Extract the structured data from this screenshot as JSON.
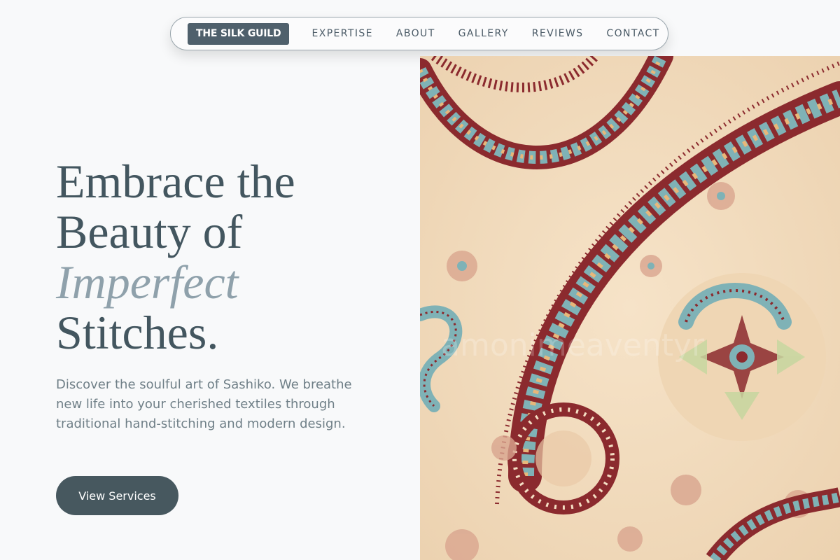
{
  "nav": {
    "logo": "THE SILK GUILD",
    "links": [
      "EXPERTISE",
      "ABOUT",
      "GALLERY",
      "REVIEWS",
      "CONTACT"
    ]
  },
  "hero": {
    "title_line1": "Embrace the",
    "title_line2": "Beauty of",
    "title_accent": "Imperfect",
    "title_line4": "Stitches.",
    "description": "Discover the soulful art of Sashiko. We breathe new life into your cherished textiles through traditional hand-stitching and modern design.",
    "cta_label": "View Services"
  },
  "image": {
    "subject": "paisley-fabric-pattern",
    "watermark": "amonimeaventyr"
  },
  "colors": {
    "primary": "#47585f",
    "accent_text": "#8fa1ab",
    "background": "#f8f9fa",
    "fabric_red": "#8b2a2e",
    "fabric_teal": "#7fb2b6",
    "fabric_cream": "#f2dcbd"
  }
}
